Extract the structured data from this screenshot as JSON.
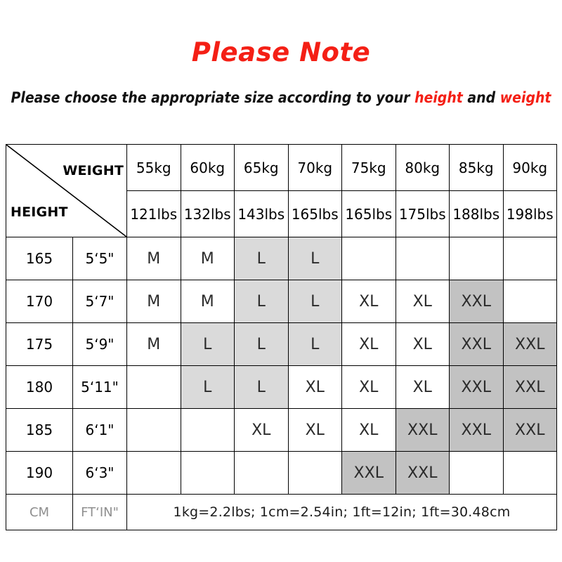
{
  "notice": {
    "title": "Please Note",
    "subtitle_prefix": "Please choose the appropriate size according to your ",
    "subtitle_height": "height",
    "subtitle_conjunction": " and ",
    "subtitle_weight": "weight",
    "title_color": "#f41f15",
    "highlight_color": "#f41f15"
  },
  "table": {
    "corner": {
      "weight_label": "WEIGHT",
      "height_label": "HEIGHT"
    },
    "weight_kg": [
      "55kg",
      "60kg",
      "65kg",
      "70kg",
      "75kg",
      "80kg",
      "85kg",
      "90kg"
    ],
    "weight_lbs": [
      "121lbs",
      "132lbs",
      "143lbs",
      "165lbs",
      "165lbs",
      "175lbs",
      "188lbs",
      "198lbs"
    ],
    "rows": [
      {
        "cm": "165",
        "ftin": "5‘5\"",
        "sizes": [
          "M",
          "M",
          "L",
          "L",
          "",
          "",
          "",
          ""
        ]
      },
      {
        "cm": "170",
        "ftin": "5‘7\"",
        "sizes": [
          "M",
          "M",
          "L",
          "L",
          "XL",
          "XL",
          "XXL",
          ""
        ]
      },
      {
        "cm": "175",
        "ftin": "5‘9\"",
        "sizes": [
          "M",
          "L",
          "L",
          "L",
          "XL",
          "XL",
          "XXL",
          "XXL"
        ]
      },
      {
        "cm": "180",
        "ftin": "5‘11\"",
        "sizes": [
          "",
          "L",
          "L",
          "XL",
          "XL",
          "XL",
          "XXL",
          "XXL"
        ]
      },
      {
        "cm": "185",
        "ftin": "6‘1\"",
        "sizes": [
          "",
          "",
          "XL",
          "XL",
          "XL",
          "XXL",
          "XXL",
          "XXL"
        ]
      },
      {
        "cm": "190",
        "ftin": "6‘3\"",
        "sizes": [
          "",
          "",
          "",
          "",
          "XXL",
          "XXL",
          "",
          ""
        ]
      }
    ],
    "footer": {
      "cm_label": "CM",
      "ftin_label": "FT‘IN\"",
      "note": "1kg=2.2lbs; 1cm=2.54in; 1ft=12in; 1ft=30.48cm"
    },
    "shading": {
      "L": "#dadada",
      "XXL": "#c2c2c2",
      "default": "#ffffff"
    }
  }
}
